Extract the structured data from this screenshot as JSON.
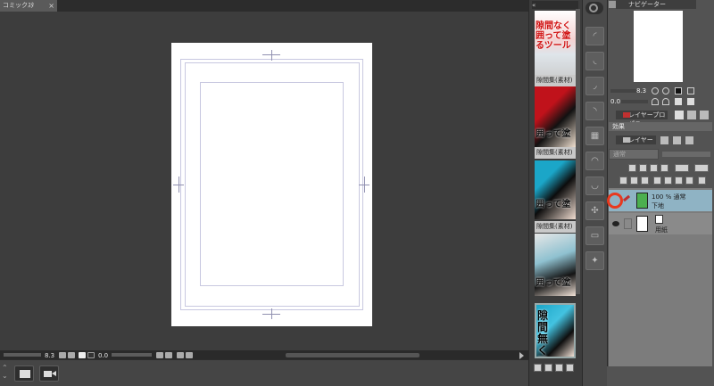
{
  "document": {
    "tab_label": "コミックｽﾀ",
    "close_glyph": "×"
  },
  "canvas": {
    "zoom": "8.3",
    "angle": "0.0"
  },
  "materials": {
    "items": [
      {
        "label": "",
        "text": "隙間なく囲って塗るツール"
      },
      {
        "label": "隙間集(素材)",
        "text": "囲って塗"
      },
      {
        "label": "隙間集(素材)",
        "text": "囲って塗"
      },
      {
        "label": "隙間集(素材)",
        "text": "囲って塗"
      },
      {
        "label": "",
        "text": "隙間無く囲って塗"
      }
    ]
  },
  "navigator": {
    "tab_label": "ナビゲーター",
    "zoom": "8.3",
    "angle": "0.0"
  },
  "layer_property": {
    "tab_label": "レイヤープロパティ",
    "effect_label": "効果"
  },
  "layers_panel": {
    "tab_label": "レイヤー",
    "blend_mode": "通常"
  },
  "layers": [
    {
      "opacity_mode": "100 % 通常",
      "name": "下地",
      "color": "#4caf50",
      "selected": true
    },
    {
      "opacity_mode": "",
      "name": "用紙",
      "color": "#ffffff",
      "selected": false
    }
  ],
  "colors": {
    "selected_layer_bg": "#8fb3c4",
    "highlight_ring": "#e8391e",
    "canvas_bg": "#3d3d3d",
    "guide": "#c8c8e0"
  },
  "icons": [
    "close-icon",
    "eye-icon",
    "pen-icon",
    "layer-icon",
    "lock-icon",
    "zoom-in-icon",
    "zoom-out-icon",
    "rotate-icon",
    "folder-icon",
    "trash-icon"
  ]
}
